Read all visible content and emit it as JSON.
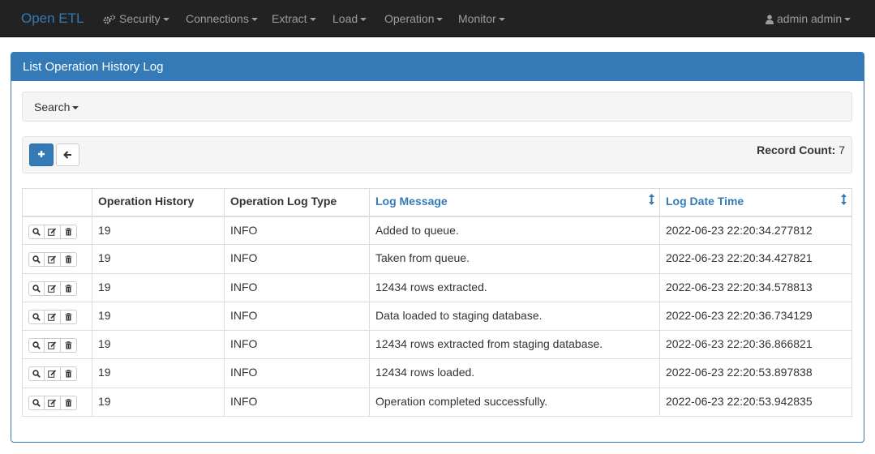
{
  "navbar": {
    "brand": "Open ETL",
    "menus": [
      "Security",
      "Connections",
      "Extract",
      "Load",
      "Operation",
      "Monitor"
    ],
    "user": "admin admin"
  },
  "panel": {
    "title": "List Operation History Log",
    "search_label": "Search",
    "record_count_label": "Record Count:",
    "record_count": "7"
  },
  "table": {
    "headers": [
      "Operation History",
      "Operation Log Type",
      "Log Message",
      "Log Date Time"
    ],
    "rows": [
      {
        "history": "19",
        "type": "INFO",
        "message": "Added to queue.",
        "datetime": "2022-06-23 22:20:34.277812"
      },
      {
        "history": "19",
        "type": "INFO",
        "message": "Taken from queue.",
        "datetime": "2022-06-23 22:20:34.427821"
      },
      {
        "history": "19",
        "type": "INFO",
        "message": "12434 rows extracted.",
        "datetime": "2022-06-23 22:20:34.578813"
      },
      {
        "history": "19",
        "type": "INFO",
        "message": "Data loaded to staging database.",
        "datetime": "2022-06-23 22:20:36.734129"
      },
      {
        "history": "19",
        "type": "INFO",
        "message": "12434 rows extracted from staging database.",
        "datetime": "2022-06-23 22:20:36.866821"
      },
      {
        "history": "19",
        "type": "INFO",
        "message": "12434 rows loaded.",
        "datetime": "2022-06-23 22:20:53.897838"
      },
      {
        "history": "19",
        "type": "INFO",
        "message": "Operation completed successfully.",
        "datetime": "2022-06-23 22:20:53.942835"
      }
    ]
  },
  "colors": {
    "primary": "#337ab7",
    "navbar": "#222222",
    "nav_text": "#9d9d9d"
  },
  "icons": [
    "gears-icon",
    "user-icon",
    "plus-icon",
    "arrow-left-icon",
    "search-icon",
    "edit-icon",
    "trash-icon",
    "sort-icon"
  ]
}
